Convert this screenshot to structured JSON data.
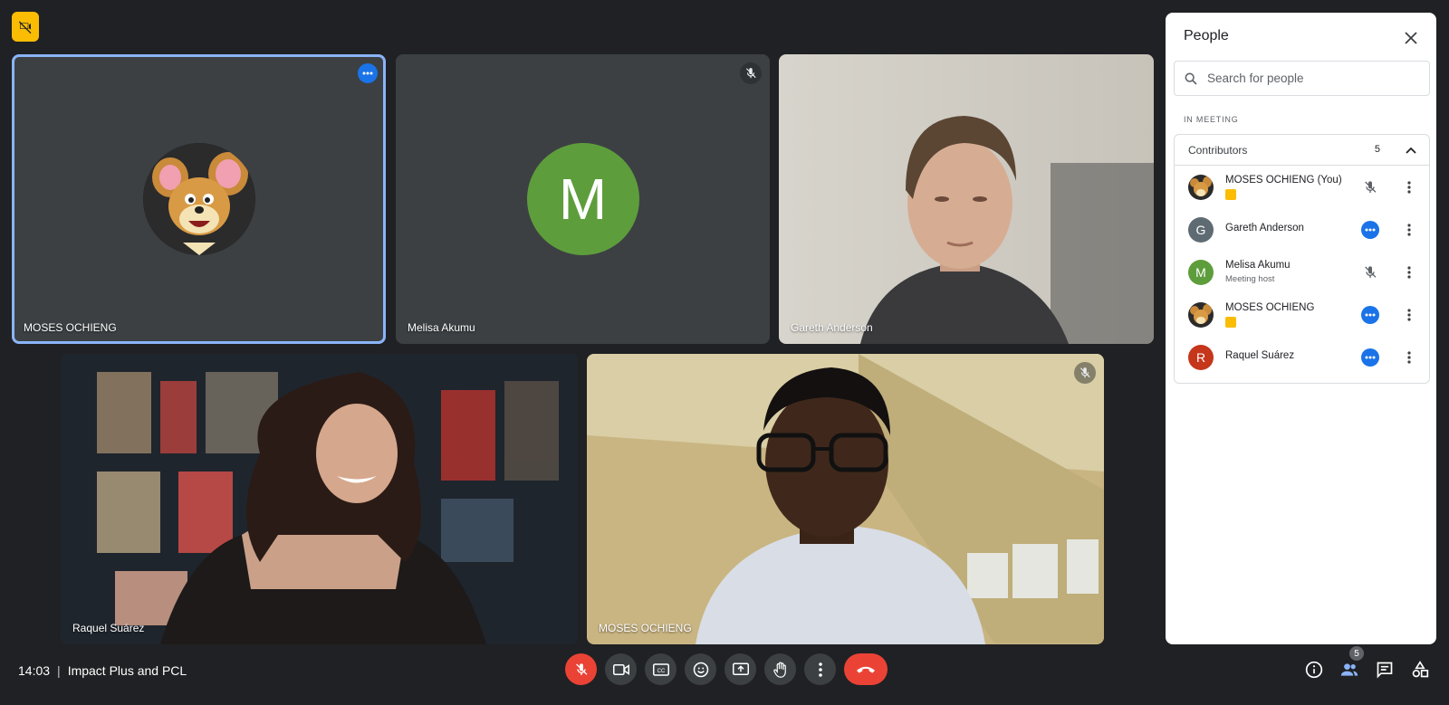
{
  "tiles": [
    {
      "name": "MOSES OCHIENG"
    },
    {
      "name": "Melisa Akumu",
      "initial": "M"
    },
    {
      "name": "Gareth Anderson"
    },
    {
      "name": "Raquel Suárez"
    },
    {
      "name": "MOSES OCHIENG"
    }
  ],
  "bottom_bar": {
    "time": "14:03",
    "separator": "|",
    "meeting_name": "Impact Plus and PCL",
    "participant_count": "5"
  },
  "people_panel": {
    "title": "People",
    "search_placeholder": "Search for people",
    "section_label": "IN MEETING",
    "group_title": "Contributors",
    "group_count": "5",
    "people": [
      {
        "name": "MOSES OCHIENG (You)",
        "sub": "",
        "initial": ""
      },
      {
        "name": "Gareth Anderson",
        "sub": "",
        "initial": "G",
        "color": "#5f6b73"
      },
      {
        "name": "Melisa Akumu",
        "sub": "Meeting host",
        "initial": "M",
        "color": "#5e9d3c"
      },
      {
        "name": "MOSES OCHIENG",
        "sub": "",
        "initial": ""
      },
      {
        "name": "Raquel Suárez",
        "sub": "",
        "initial": "R",
        "color": "#c5361b"
      }
    ]
  },
  "colors": {
    "background": "#202124",
    "tile": "#3c4043",
    "accent_blue": "#1a73e8",
    "active_outline": "#8ab4f8",
    "hangup_red": "#ea4335",
    "recording_yellow": "#fbbc04"
  }
}
